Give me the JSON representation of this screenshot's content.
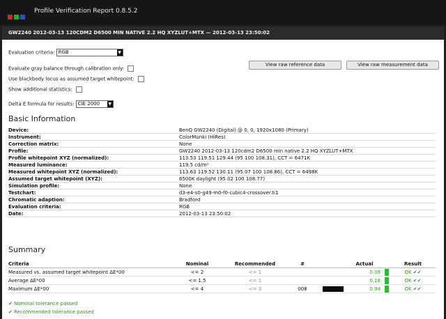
{
  "app": {
    "title": "Profile Verification Report 0.8.5.2",
    "logo_colors": [
      "#e02020",
      "#20b020",
      "#2050e0"
    ]
  },
  "report": {
    "header": "GW2240 2012-03-13 120CDM2 D6500 MIN NATIVE 2.2 HQ XYZLUT+MTX — 2012-03-13 23:50:02"
  },
  "controls": {
    "evaluation_label": "Evaluation criteria:",
    "evaluation_value": "RGB",
    "gray_balance_label": "Evaluate gray balance through calibration only:",
    "blackbody_label": "Use blackbody locus as assumed target whitepoint:",
    "additional_stats_label": "Show additional statistics:",
    "delta_e_label": "Delta E formula for results:",
    "delta_e_value": "CIE 2000",
    "view_reference_button": "View raw reference data",
    "view_measurement_button": "View raw measurement data"
  },
  "basic_info": {
    "heading": "Basic Information",
    "rows": [
      {
        "key": "Device:",
        "value": "BenQ GW2240 (Digital) @ 0, 0, 1920x1080 (Primary)"
      },
      {
        "key": "Instrument:",
        "value": "ColorMunki (HiRes)"
      },
      {
        "key": "Correction matrix:",
        "value": "None"
      },
      {
        "key": "Profile:",
        "value": "GW2240 2012-03-13 120cdm2 D6500 min native 2.2 HQ XYZLUT+MTX"
      },
      {
        "key": "Profile whitepoint XYZ (normalized):",
        "value": "113.53 119.51 129.44 (95 100 108.31), CCT = 6471K"
      },
      {
        "key": "Measured luminance:",
        "value": "119.5 cd/m²"
      },
      {
        "key": "Measured whitepoint XYZ (normalized):",
        "value": "113.63 119.52 130.11 (95.07 100 108.86), CCT = 6498K"
      },
      {
        "key": "Assumed target whitepoint (XYZ):",
        "value": "6500K daylight (95.02 100 108.77)"
      },
      {
        "key": "Simulation profile:",
        "value": "None"
      },
      {
        "key": "Testchart:",
        "value": "d3-e4-s0-g49-m0-f0-cubic4-crossover.ti1"
      },
      {
        "key": "Chromatic adaption:",
        "value": "Bradford"
      },
      {
        "key": "Evaluation criteria:",
        "value": "RGB"
      },
      {
        "key": "Date:",
        "value": "2012-03-13 23:50:02"
      }
    ]
  },
  "summary": {
    "heading": "Summary",
    "columns": [
      "Criteria",
      "Nominal",
      "Recommended",
      "#",
      "Actual",
      "Result"
    ],
    "rows": [
      {
        "criteria": "Measured vs. assumed target whitepoint ΔE*00",
        "nominal": "<= 2",
        "recommended": "<= 1",
        "num": "",
        "actual": "0.09",
        "result": "OK ✔✔"
      },
      {
        "criteria": "Average ΔE*00",
        "nominal": "<= 1.5",
        "recommended": "<= 1",
        "num": "",
        "actual": "0.18",
        "result": "OK ✔✔"
      },
      {
        "criteria": "Maximum ΔE*00",
        "nominal": "<= 4",
        "recommended": "<= 3",
        "num": "008",
        "actual": "0.94",
        "result": "OK ✔✔"
      }
    ],
    "bar_color": "#22c22a",
    "nominal_passed": "✔ Nominal tolerance passed",
    "recommended_passed": "✔ Recommended tolerance passed"
  }
}
